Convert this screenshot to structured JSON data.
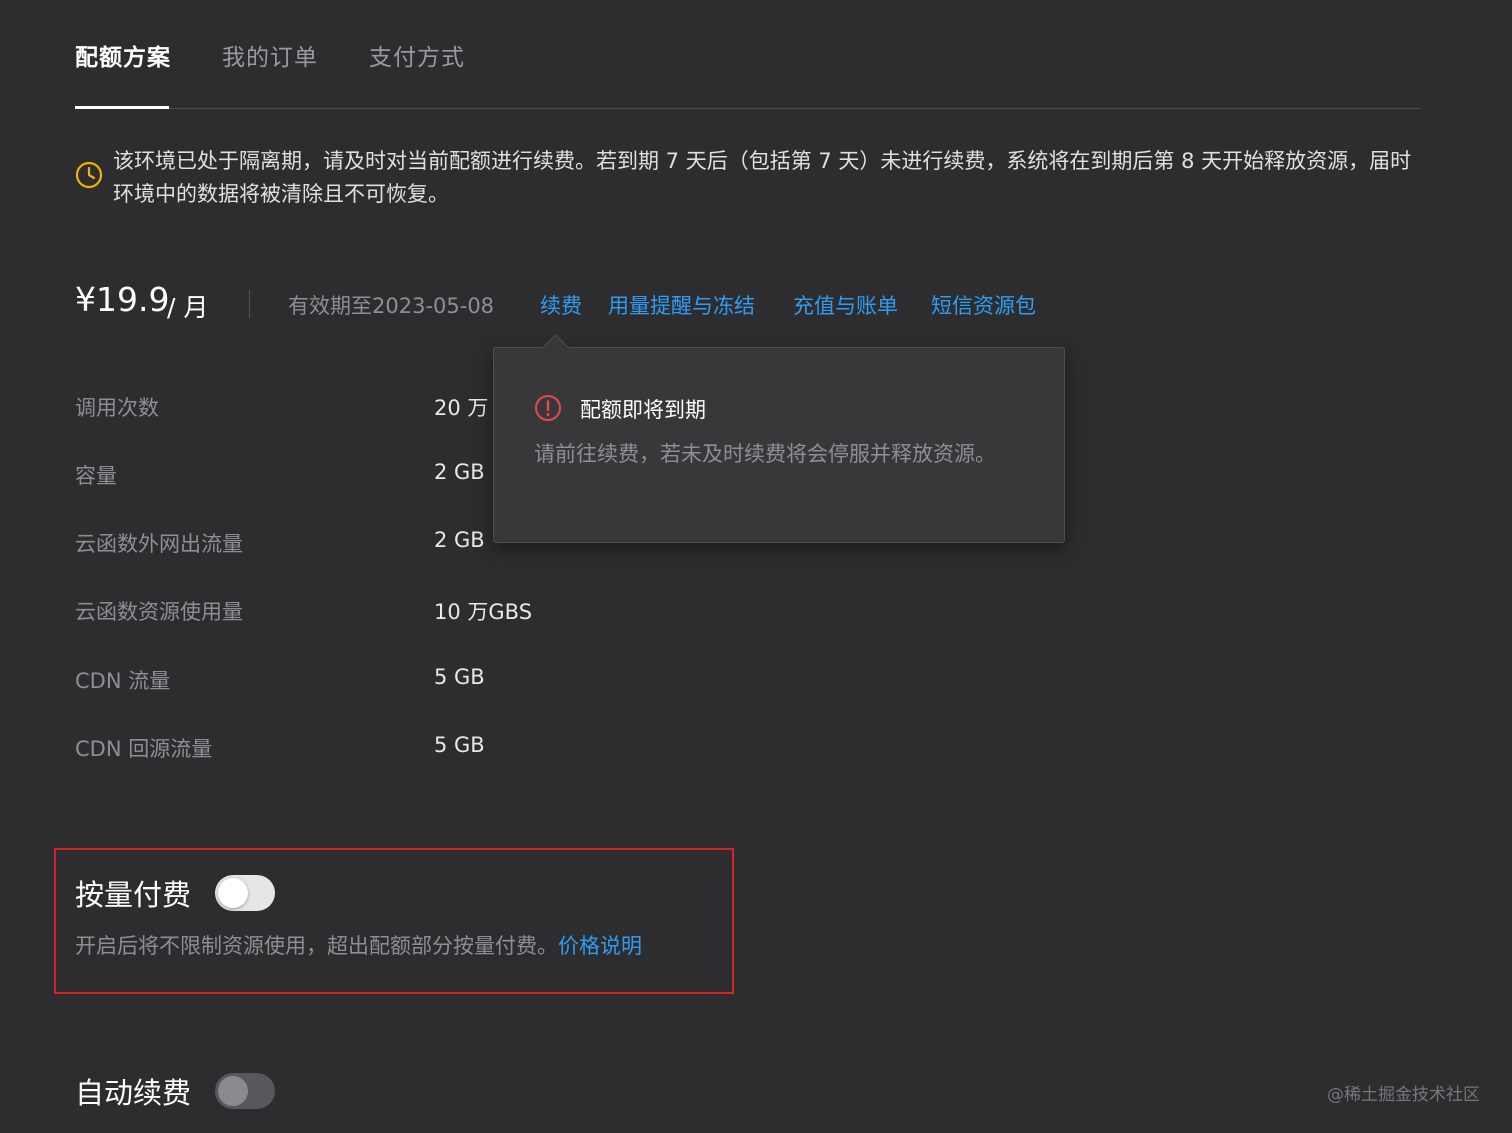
{
  "tabs": [
    {
      "label": "配额方案",
      "active": true
    },
    {
      "label": "我的订单",
      "active": false
    },
    {
      "label": "支付方式",
      "active": false
    }
  ],
  "notice": {
    "icon": "clock-icon",
    "color": "#f0b400",
    "text": "该环境已处于隔离期，请及时对当前配额进行续费。若到期 7 天后（包括第 7 天）未进行续费，系统将在到期后第 8 天开始释放资源，届时环境中的数据将被清除且不可恢复。"
  },
  "plan": {
    "price": "¥19.9",
    "unit": "/ 月",
    "validity": "有效期至2023-05-08",
    "links": {
      "renew": "续费",
      "usage_alert": "用量提醒与冻结",
      "recharge": "充值与账单",
      "sms": "短信资源包"
    }
  },
  "quota": [
    {
      "label": "调用次数",
      "value": "20 万"
    },
    {
      "label": "容量",
      "value": "2 GB"
    },
    {
      "label": "云函数外网出流量",
      "value": "2 GB"
    },
    {
      "label": "云函数资源使用量",
      "value": "10 万GBS"
    },
    {
      "label": "CDN 流量",
      "value": "5 GB"
    },
    {
      "label": "CDN 回源流量",
      "value": "5 GB"
    }
  ],
  "popover": {
    "icon": "alert-circle-icon",
    "icon_color": "#e5484d",
    "title": "配额即将到期",
    "desc": "请前往续费，若未及时续费将会停服并释放资源。"
  },
  "pay_as_you_go": {
    "title": "按量付费",
    "enabled": false,
    "desc": "开启后将不限制资源使用，超出配额部分按量付费。",
    "link": "价格说明"
  },
  "auto_renew": {
    "title": "自动续费",
    "enabled": false,
    "disabled": true
  },
  "watermark": "@稀土掘金技术社区",
  "colors": {
    "accent": "#2f9cf1",
    "highlight_border": "#d0232a",
    "background": "#2d2d2f"
  }
}
